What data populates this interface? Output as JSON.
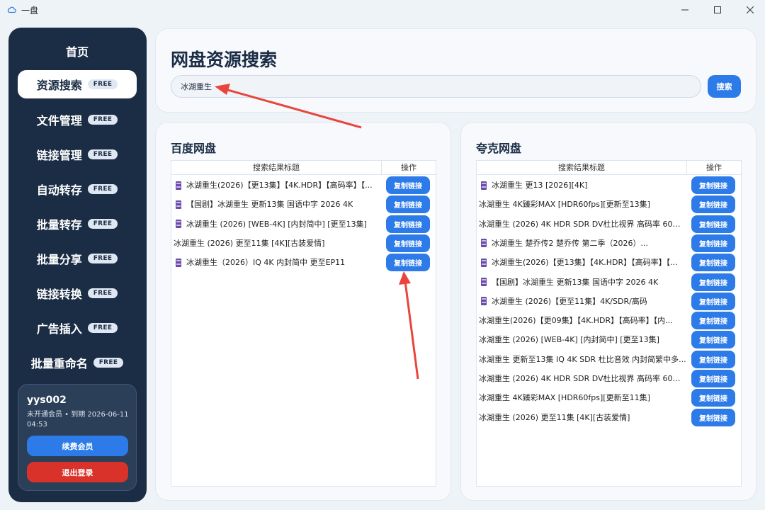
{
  "window": {
    "title": "一盘",
    "icon": "cloud-icon"
  },
  "sidebar": {
    "items": [
      {
        "label": "首页",
        "badge": ""
      },
      {
        "label": "资源搜索",
        "badge": "FREE",
        "active": true
      },
      {
        "label": "文件管理",
        "badge": "FREE"
      },
      {
        "label": "链接管理",
        "badge": "FREE"
      },
      {
        "label": "自动转存",
        "badge": "FREE"
      },
      {
        "label": "批量转存",
        "badge": "FREE"
      },
      {
        "label": "批量分享",
        "badge": "FREE"
      },
      {
        "label": "链接转换",
        "badge": "FREE"
      },
      {
        "label": "广告插入",
        "badge": "FREE"
      },
      {
        "label": "批量重命名",
        "badge": "FREE"
      }
    ],
    "user": {
      "name": "yys002",
      "status": "未开通会员 • 到期 2026-06-11 04:53",
      "renew_label": "续费会员",
      "logout_label": "退出登录"
    }
  },
  "search": {
    "title": "网盘资源搜索",
    "value": "冰湖重生",
    "button_label": "搜索"
  },
  "baidu": {
    "title": "百度网盘",
    "col_title": "搜索结果标题",
    "col_op": "操作",
    "copy_label": "复制链接",
    "rows": [
      {
        "icon": true,
        "title": "冰湖重生(2026)【更13集】【4K.HDR】【高码率】【..."
      },
      {
        "icon": true,
        "title": "【国剧】冰湖重生 更新13集 国语中字 2026 4K"
      },
      {
        "icon": true,
        "title": "冰湖重生 (2026) [WEB-4K] [内封简中] [更至13集]"
      },
      {
        "icon": false,
        "title": "冰湖重生 (2026) 更至11集 [4K][古装爱情]"
      },
      {
        "icon": true,
        "title": "冰湖重生（2026）IQ 4K 内封简中 更至EP11"
      }
    ]
  },
  "quark": {
    "title": "夸克网盘",
    "col_title": "搜索结果标题",
    "col_op": "操作",
    "copy_label": "复制链接",
    "rows": [
      {
        "icon": true,
        "title": "冰湖重生 更13 [2026][4K]"
      },
      {
        "icon": false,
        "title": "冰湖重生 4K臻彩MAX [HDR60fps][更新至13集]"
      },
      {
        "icon": false,
        "title": "冰湖重生 (2026) 4K HDR SDR DV杜比视界 高码率 60帧 ..."
      },
      {
        "icon": true,
        "title": "冰湖重生 楚乔传2 楚乔传 第二季（2026）..."
      },
      {
        "icon": true,
        "title": "冰湖重生(2026)【更13集】【4K.HDR】【高码率】【..."
      },
      {
        "icon": true,
        "title": "【国剧】冰湖重生 更新13集 国语中字 2026 4K"
      },
      {
        "icon": true,
        "title": "冰湖重生 (2026)【更至11集】4K/SDR/高码"
      },
      {
        "icon": false,
        "title": "冰湖重生(2026)【更09集】【4K.HDR】【高码率】【内..."
      },
      {
        "icon": false,
        "title": "冰湖重生 (2026) [WEB-4K] [内封简中] [更至13集]"
      },
      {
        "icon": false,
        "title": "冰湖重生 更新至13集 IQ 4K SDR 杜比音效 内封简繁中多..."
      },
      {
        "icon": false,
        "title": "冰湖重生 (2026) 4K HDR SDR DV杜比视界 高码率 60帧 ..."
      },
      {
        "icon": false,
        "title": "冰湖重生 4K臻彩MAX [HDR60fps][更新至11集]"
      },
      {
        "icon": false,
        "title": "冰湖重生 (2026) 更至11集 [4K][古装爱情]"
      }
    ]
  },
  "colors": {
    "sidebar_bg": "#1b2d45",
    "accent": "#2d7be8",
    "danger": "#d9322a",
    "annotation_arrow": "#e8453c"
  }
}
